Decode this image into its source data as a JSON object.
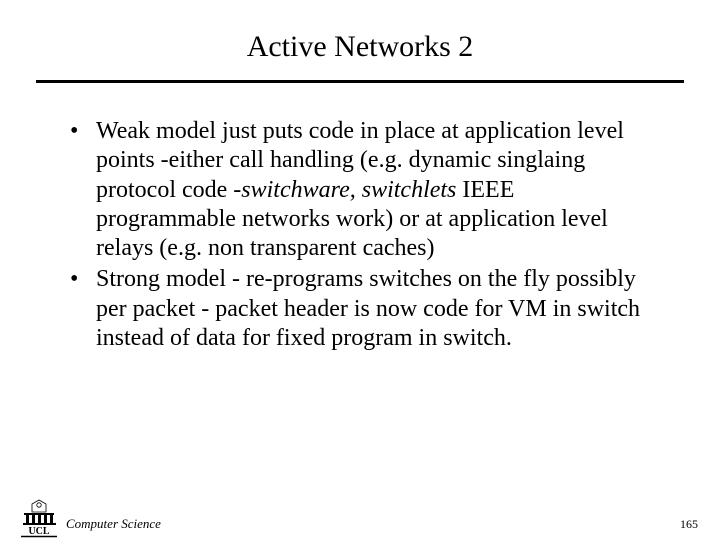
{
  "title": "Active Networks 2",
  "bullets": [
    {
      "pre": "Weak model just puts code in place at application level points -either call handling (e.g. dynamic singlaing protocol code -",
      "italic": "switchware, switchlets",
      "post": " IEEE programmable networks work) or at application level relays (e.g. non transparent caches)"
    },
    {
      "text": "Strong model - re-programs switches on the fly possibly per packet - packet header is now code for VM in switch instead of data for fixed program in switch."
    }
  ],
  "footer": {
    "logo_top": "UCL",
    "department": "Computer Science",
    "page": "165"
  }
}
